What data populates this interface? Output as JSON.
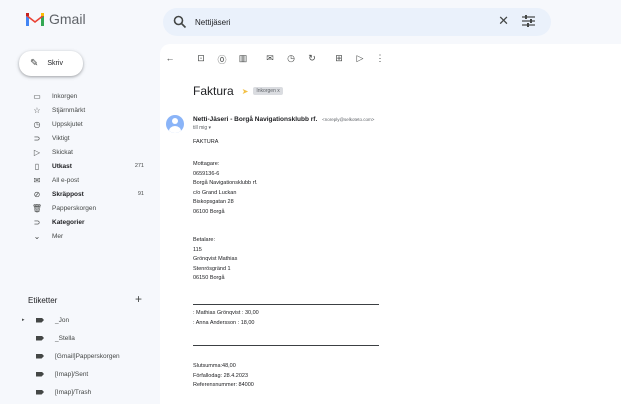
{
  "app": {
    "name": "Gmail"
  },
  "search": {
    "value": "Nettijäseri"
  },
  "compose": {
    "label": "Skriv"
  },
  "nav": [
    {
      "icon": "inbox-icon",
      "glyph": "▭",
      "label": "Inkorgen",
      "count": ""
    },
    {
      "icon": "star-icon",
      "glyph": "☆",
      "label": "Stjärnmärkt",
      "count": ""
    },
    {
      "icon": "clock-icon",
      "glyph": "◷",
      "label": "Uppskjutet",
      "count": ""
    },
    {
      "icon": "important-icon",
      "glyph": "⊃",
      "label": "Viktigt",
      "count": ""
    },
    {
      "icon": "send-icon",
      "glyph": "▷",
      "label": "Skickat",
      "count": ""
    },
    {
      "icon": "draft-icon",
      "glyph": "▯",
      "label": "Utkast",
      "count": "271"
    },
    {
      "icon": "all-mail-icon",
      "glyph": "✉",
      "label": "All e-post",
      "count": ""
    },
    {
      "icon": "spam-icon",
      "glyph": "⊘",
      "label": "Skräppost",
      "count": "91"
    },
    {
      "icon": "trash-icon",
      "glyph": "🗑",
      "label": "Papperskorgen",
      "count": ""
    },
    {
      "icon": "categories-icon",
      "glyph": "⊃",
      "label": "Kategorier",
      "count": ""
    },
    {
      "icon": "chevron-down-icon",
      "glyph": "⌄",
      "label": "Mer",
      "count": ""
    }
  ],
  "labels": {
    "header": "Etiketter",
    "items": [
      "_Jon",
      "_Stella",
      "[Gmail]Papperskorgen",
      "[Imap]/Sent",
      "[Imap]/Trash"
    ]
  },
  "email": {
    "subject": "Faktura",
    "tag": "Inkorgen x",
    "sender_name": "Netti-Jäseri - Borgå Navigationsklubb rf.",
    "sender_email": "<noreply@selkoteto.com>",
    "to": "till mig ▾",
    "title": "FAKTURA",
    "mottagare": [
      "Mottagare:",
      "0659136-6",
      "Borgå Navigationsklubb rf.",
      "c/o Grand Luckan",
      "Biskopsgatan 28",
      "06100 Borgå"
    ],
    "betalare": [
      "Betalare:",
      "115",
      "Grönqvist Mathias",
      "Stenrösgränd 1",
      "06150 Borgå"
    ],
    "rows": [
      ": Mathias Grönqvist : 30,00",
      ": Anna Andersson : 18,00"
    ],
    "footer": [
      "Slutsumma:48,00",
      "Förfallodag: 28.4.2023",
      "Referensnummer: 84000"
    ]
  }
}
